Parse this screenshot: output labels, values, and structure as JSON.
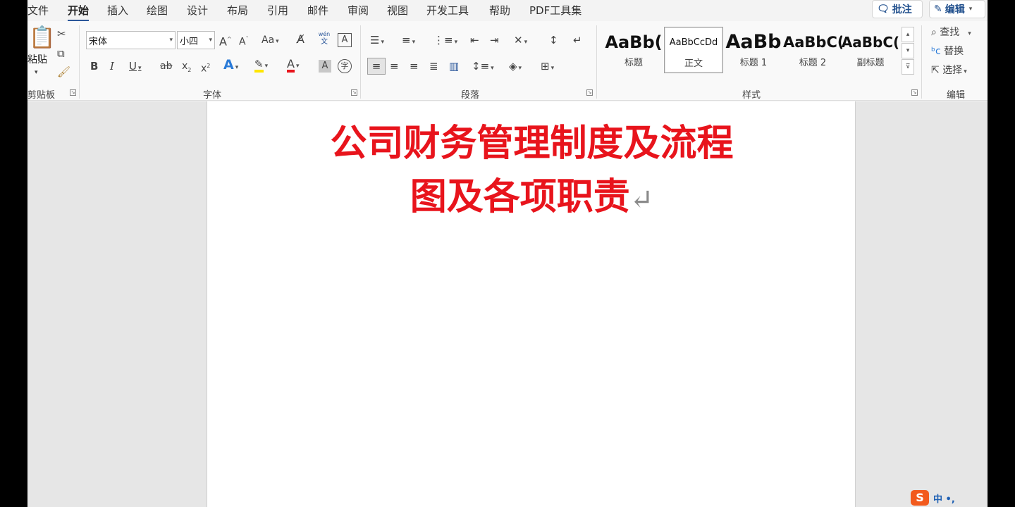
{
  "tabs": [
    "文件",
    "开始",
    "插入",
    "绘图",
    "设计",
    "布局",
    "引用",
    "邮件",
    "审阅",
    "视图",
    "开发工具",
    "帮助",
    "PDF工具集"
  ],
  "top_buttons": {
    "comment": "批注",
    "edit": "编辑"
  },
  "clipboard": {
    "paste": "粘贴",
    "label": "剪贴板"
  },
  "font": {
    "name": "宋体",
    "size": "小四",
    "case_label": "Aa",
    "phonetic_top": "wén",
    "phonetic_bottom": "文",
    "label": "字体"
  },
  "paragraph": {
    "label": "段落"
  },
  "styles": {
    "label": "样式",
    "items": [
      {
        "preview": "AaBb(",
        "name": "标题"
      },
      {
        "preview": "AaBbCcDd",
        "name": "正文"
      },
      {
        "preview": "AaBb",
        "name": "标题 1"
      },
      {
        "preview": "AaBbC(",
        "name": "标题 2"
      },
      {
        "preview": "AaBbC(",
        "name": "副标题"
      }
    ]
  },
  "editing": {
    "find": "查找",
    "replace": "替换",
    "select": "选择",
    "label": "编辑"
  },
  "document": {
    "title_line1": "公司财务管理制度及流程",
    "title_line2": "图及各项职责",
    "para_mark": "↵"
  },
  "ime": {
    "logo": "S",
    "mode": "中 •,"
  },
  "colors": {
    "title_red": "#e8141c",
    "accent": "#2b579a",
    "highlight_yellow": "#ffe600",
    "font_color_red": "#e8141c"
  }
}
